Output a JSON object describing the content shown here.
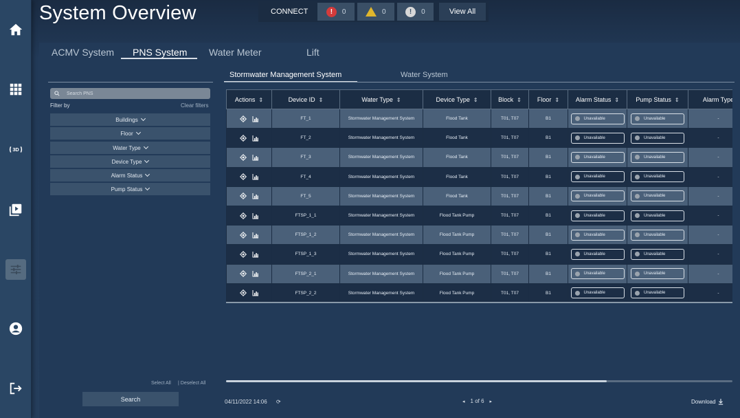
{
  "app": {
    "title": "System Overview"
  },
  "alerts": {
    "connect_label": "CONNECT",
    "critical_count": "0",
    "warning_count": "0",
    "info_count": "0",
    "view_all_label": "View All",
    "critical_icon": "error-icon",
    "warning_icon": "warning-icon",
    "info_icon": "info-icon"
  },
  "sidebar": {
    "items": [
      {
        "name": "home",
        "icon": "home-icon"
      },
      {
        "name": "apps",
        "icon": "grid-icon"
      },
      {
        "name": "3d",
        "icon": "3d-icon",
        "label": "3D"
      },
      {
        "name": "media",
        "icon": "play-library-icon"
      },
      {
        "name": "settings",
        "icon": "sliders-icon",
        "active": true
      },
      {
        "name": "account",
        "icon": "account-icon"
      },
      {
        "name": "logout",
        "icon": "logout-icon"
      }
    ]
  },
  "main_tabs": [
    {
      "label": "ACMV System",
      "active": false
    },
    {
      "label": "PNS System",
      "active": true
    },
    {
      "label": "Water Meter",
      "active": false
    },
    {
      "label": "Lift",
      "active": false
    }
  ],
  "filters": {
    "search_placeholder": "Search PNS",
    "filter_by_label": "Filter by",
    "clear_filters_label": "Clear filters",
    "buttons": [
      "Buildings",
      "Floor",
      "Water Type",
      "Device Type",
      "Alarm Status",
      "Pump Status"
    ],
    "select_all_label": "Select All",
    "deselect_all_label": "| Deselect All",
    "search_button_label": "Search"
  },
  "sub_tabs": [
    {
      "label": "Stormwater Management System",
      "active": true
    },
    {
      "label": "Water System",
      "active": false
    }
  ],
  "table": {
    "columns": [
      "Actions",
      "Device ID",
      "Water Type",
      "Device Type",
      "Block",
      "Floor",
      "Alarm Status",
      "Pump Status",
      "Alarm Type"
    ],
    "rows": [
      {
        "device_id": "FT_1",
        "water_type": "Stormwater Management System",
        "device_type": "Flood Tank",
        "block": "T01, T07",
        "floor": "B1",
        "alarm_status": "Unavailable",
        "pump_status": "Unavailable",
        "alarm_type": "-"
      },
      {
        "device_id": "FT_2",
        "water_type": "Stormwater Management System",
        "device_type": "Flood Tank",
        "block": "T01, T07",
        "floor": "B1",
        "alarm_status": "Unavailable",
        "pump_status": "Unavailable",
        "alarm_type": "-"
      },
      {
        "device_id": "FT_3",
        "water_type": "Stormwater Management System",
        "device_type": "Flood Tank",
        "block": "T01, T07",
        "floor": "B1",
        "alarm_status": "Unavailable",
        "pump_status": "Unavailable",
        "alarm_type": "-"
      },
      {
        "device_id": "FT_4",
        "water_type": "Stormwater Management System",
        "device_type": "Flood Tank",
        "block": "T01, T07",
        "floor": "B1",
        "alarm_status": "Unavailable",
        "pump_status": "Unavailable",
        "alarm_type": "-"
      },
      {
        "device_id": "FT_5",
        "water_type": "Stormwater Management System",
        "device_type": "Flood Tank",
        "block": "T01, T07",
        "floor": "B1",
        "alarm_status": "Unavailable",
        "pump_status": "Unavailable",
        "alarm_type": "-"
      },
      {
        "device_id": "FTSP_1_1",
        "water_type": "Stormwater Management System",
        "device_type": "Flood Tank Pump",
        "block": "T01, T07",
        "floor": "B1",
        "alarm_status": "Unavailable",
        "pump_status": "Unavailable",
        "alarm_type": "-"
      },
      {
        "device_id": "FTSP_1_2",
        "water_type": "Stormwater Management System",
        "device_type": "Flood Tank Pump",
        "block": "T01, T07",
        "floor": "B1",
        "alarm_status": "Unavailable",
        "pump_status": "Unavailable",
        "alarm_type": "-"
      },
      {
        "device_id": "FTSP_1_3",
        "water_type": "Stormwater Management System",
        "device_type": "Flood Tank Pump",
        "block": "T01, T07",
        "floor": "B1",
        "alarm_status": "Unavailable",
        "pump_status": "Unavailable",
        "alarm_type": "-"
      },
      {
        "device_id": "FTSP_2_1",
        "water_type": "Stormwater Management System",
        "device_type": "Flood Tank Pump",
        "block": "T01, T07",
        "floor": "B1",
        "alarm_status": "Unavailable",
        "pump_status": "Unavailable",
        "alarm_type": "-"
      },
      {
        "device_id": "FTSP_2_2",
        "water_type": "Stormwater Management System",
        "device_type": "Flood Tank Pump",
        "block": "T01, T07",
        "floor": "B1",
        "alarm_status": "Unavailable",
        "pump_status": "Unavailable",
        "alarm_type": "-"
      }
    ]
  },
  "footer": {
    "timestamp": "04/11/2022 14:06",
    "refresh_icon": "refresh-icon",
    "pager_text": "1 of 6",
    "download_label": "Download",
    "download_icon": "download-icon"
  },
  "colors": {
    "background": "#223a58",
    "sidebar": "#2a4664",
    "row_light": "#4a6079",
    "row_dark": "#1c2e46",
    "critical": "#d43b3b",
    "warning": "#e0b62c"
  }
}
